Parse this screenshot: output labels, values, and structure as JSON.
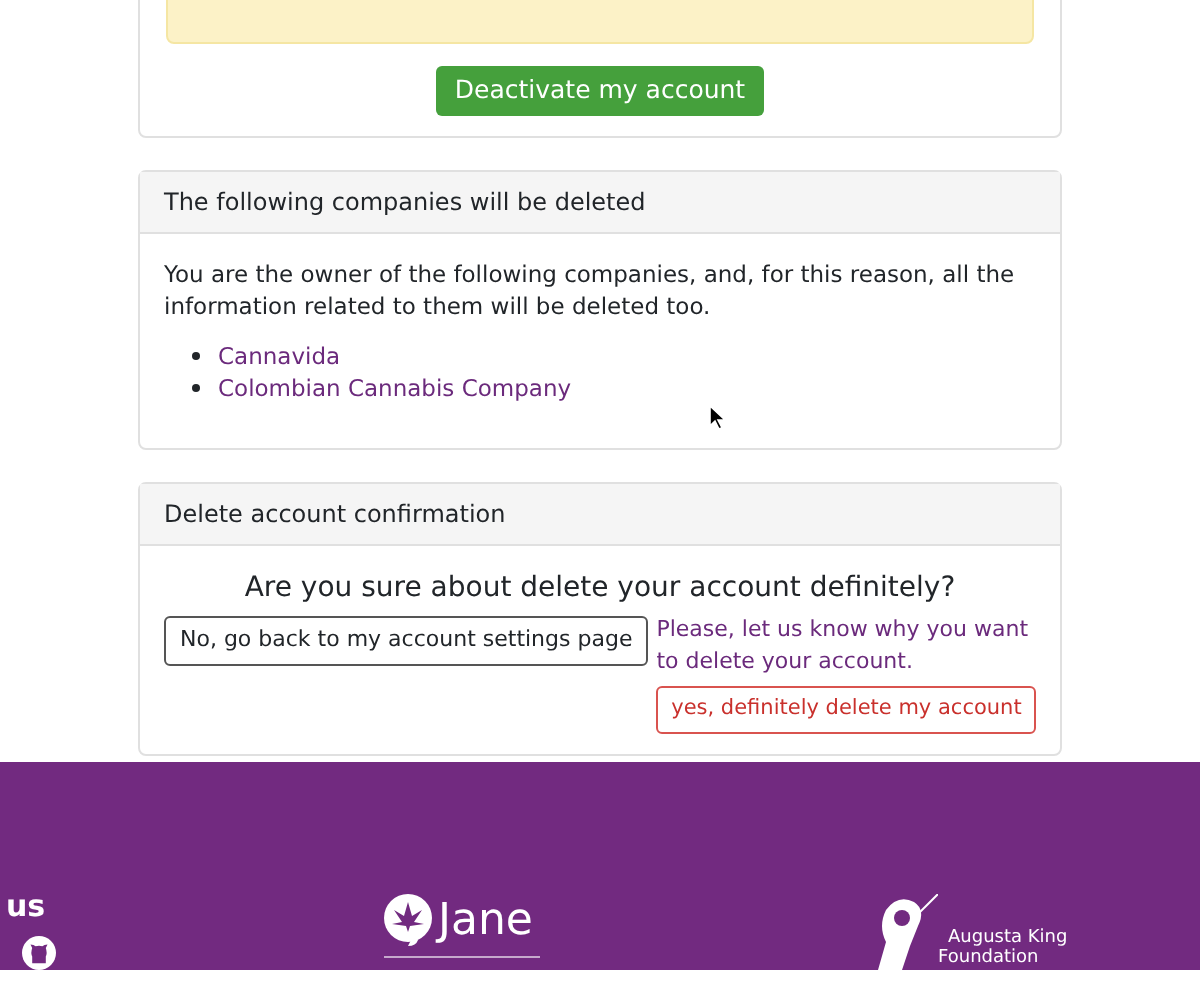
{
  "deactivate_card": {
    "button": "Deactivate my account"
  },
  "companies_card": {
    "title": "The following companies will be deleted",
    "text": "You are the owner of the following companies, and, for this reason, all the information related to them will be deleted too.",
    "companies": [
      "Cannavida",
      "Colombian Cannabis Company"
    ]
  },
  "confirmation_card": {
    "title": "Delete account confirmation",
    "question": "Are you sure about delete your account definitely?",
    "back_button": "No, go back to my account settings page",
    "feedback_link": "Please, let us know why you want to delete your account.",
    "delete_button": "yes, definitely delete my account"
  },
  "footer": {
    "heading": "us",
    "logo_text": "Jane",
    "foundation_lines": [
      "Augusta King",
      "Foundation"
    ]
  }
}
